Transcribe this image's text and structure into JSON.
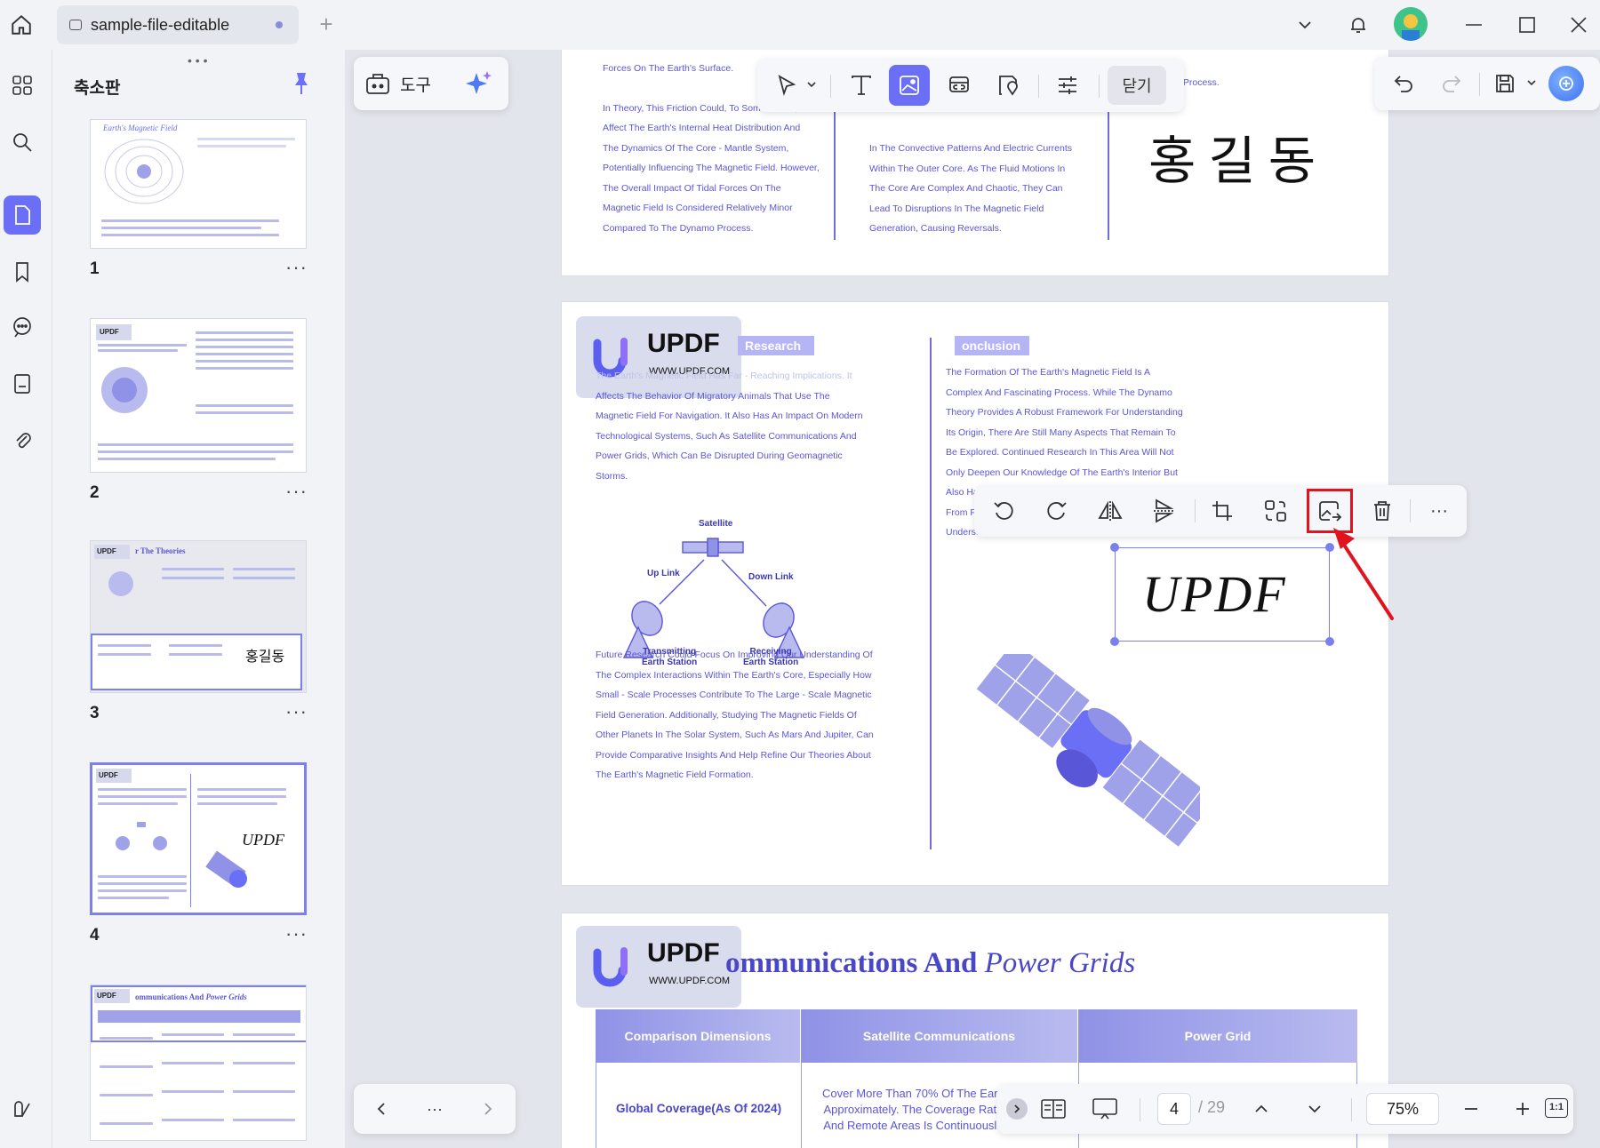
{
  "window": {
    "tab_title": "sample-file-editable",
    "new_tab": "+"
  },
  "sidebar": {
    "panel_title": "축소판",
    "thumbnails": [
      {
        "number": "1",
        "more": "···"
      },
      {
        "number": "2",
        "more": "···"
      },
      {
        "number": "3",
        "more": "···"
      },
      {
        "number": "4",
        "more": "···"
      }
    ]
  },
  "toolbar": {
    "tools_label": "도구",
    "close_label": "닫기"
  },
  "page_top": {
    "col1": [
      "Forces On The Earth's Surface.",
      "",
      "In Theory, This Friction Could, To Some Extent,",
      "Affect The Earth's Internal Heat Distribution And",
      "The Dynamics Of The Core - Mantle System,",
      "Potentially Influencing The Magnetic Field. However,",
      "The Overall Impact Of Tidal Forces On The",
      "Magnetic Field Is Considered Relatively Minor",
      "Compared To The Dynamo Process."
    ],
    "col2": [
      "In The Convective Patterns And Electric Currents",
      "Within The Outer Core. As The Fluid Motions In",
      "The Core Are Complex And Chaotic, They Can",
      "Lead To Disruptions In The Magnetic Field",
      "Generation, Causing Reversals."
    ],
    "col3_top": "Generation Process.",
    "handwriting": "홍길동"
  },
  "page_mid": {
    "research_label": "Research",
    "conclusion_label": "onclusion",
    "left_para1": [
      "The Earth's Magnetic Field Has Far - Reaching Implications. It",
      "Affects The Behavior Of Migratory Animals That Use The",
      "Magnetic Field For Navigation. It Also Has An Impact On Modern",
      "Technological Systems, Such As Satellite Communications And",
      "Power Grids, Which Can Be Disrupted During Geomagnetic",
      "Storms."
    ],
    "diagram": {
      "satellite": "Satellite",
      "uplink": "Up Link",
      "downlink": "Down Link",
      "tx1": "Transmitting",
      "tx2": "Earth Station",
      "rx1": "Receiving",
      "rx2": "Earth Station"
    },
    "left_para2": [
      "Future Research Could Focus On Improving Our Understanding Of",
      "The Complex Interactions Within The Earth's Core, Especially How",
      "Small - Scale Processes Contribute To The Large - Scale Magnetic",
      "Field Generation. Additionally, Studying The Magnetic Fields Of",
      "Other Planets In The Solar System, Such As Mars And Jupiter, Can",
      "Provide Comparative Insights And Help Refine Our Theories About",
      "The Earth's Magnetic Field Formation."
    ],
    "right_para": [
      "The Formation Of The Earth's Magnetic Field Is A",
      "Complex And Fascinating Process. While The Dynamo",
      "Theory Provides A Robust Framework For Understanding",
      "Its Origin, There Are Still Many Aspects That Remain To",
      "Be Explored. Continued Research In This Area Will Not",
      "Only Deepen Our Knowledge Of The Earth's Interior But",
      "Also Ha",
      "From F",
      "Understanding Of The Universe."
    ],
    "signature": "UPDF"
  },
  "logo": {
    "word": "UPDF",
    "url": "WWW.UPDF.COM"
  },
  "page_bottom": {
    "heading_bold": "ommunications And ",
    "heading_italic": "Power Grids",
    "table_headers": [
      "Comparison Dimensions",
      "Satellite Communications",
      "Power Grid"
    ],
    "row1_label": "Global Coverage(As Of 2024)",
    "row1_text": [
      "Cover More Than 70% Of The Ear",
      "Approximately. The Coverage Rat",
      "And Remote Areas Is Continuousl"
    ]
  },
  "bottom_bar": {
    "current_page": "4",
    "total_pages": "/ 29",
    "zoom": "75%",
    "fit": "1:1"
  },
  "colors": {
    "accent": "#6b6ff5",
    "page_text": "#5a56d8",
    "highlight_box": "#e0141e"
  }
}
